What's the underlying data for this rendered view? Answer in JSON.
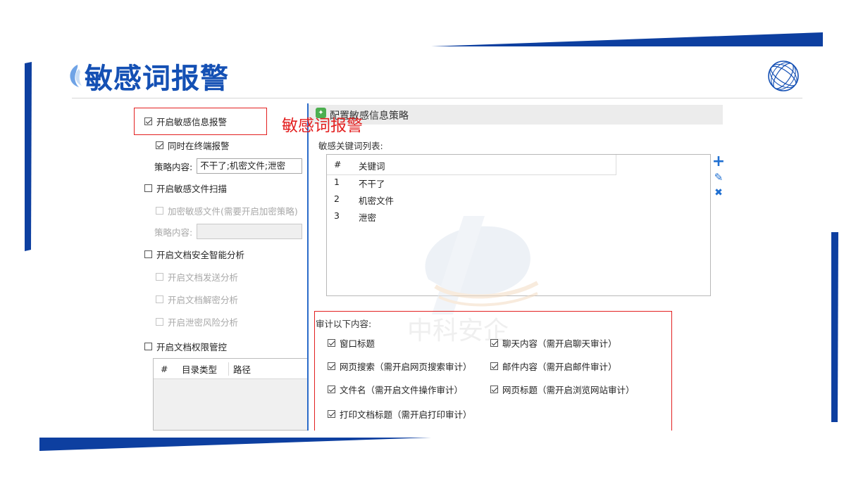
{
  "slide": {
    "title": "敏感词报警",
    "colors": {
      "brand": "#1450b4",
      "accent_dark": "#0d3fa0",
      "alert": "#e32020"
    },
    "icons": [
      "title-marker-icon",
      "globe-logo-icon"
    ]
  },
  "left_panel": {
    "items": [
      {
        "label": "开启敏感信息报警",
        "checked": true,
        "enabled": true
      },
      {
        "label": "同时在终端报警",
        "checked": true,
        "enabled": true
      },
      {
        "label": "开启敏感文件扫描",
        "checked": false,
        "enabled": true
      },
      {
        "label": "加密敏感文件(需要开启加密策略)",
        "checked": false,
        "enabled": false
      },
      {
        "label": "开启文档安全智能分析",
        "checked": false,
        "enabled": true
      },
      {
        "label": "开启文档发送分析",
        "checked": false,
        "enabled": false
      },
      {
        "label": "开启文档解密分析",
        "checked": false,
        "enabled": false
      },
      {
        "label": "开启泄密风险分析",
        "checked": false,
        "enabled": false
      },
      {
        "label": "开启文档权限管控",
        "checked": false,
        "enabled": true
      }
    ],
    "policy_label_1": "策略内容:",
    "policy_value_1": "不干了;机密文件;泄密",
    "policy_label_2": "策略内容:",
    "policy_value_2": "",
    "table_headers": [
      "#",
      "目录类型",
      "路径"
    ]
  },
  "right_panel": {
    "title": "配置敏感信息策略",
    "overlay_label": "敏感词报警",
    "keyword_list_label": "敏感关键词列表:",
    "keyword_table": {
      "headers": [
        "#",
        "关键词"
      ],
      "rows": [
        {
          "num": "1",
          "keyword": "不干了"
        },
        {
          "num": "2",
          "keyword": "机密文件"
        },
        {
          "num": "3",
          "keyword": "泄密"
        }
      ]
    },
    "tools": {
      "add": "+",
      "edit": "✎",
      "delete": "✖"
    },
    "watermark_text": "中科安企",
    "audit_label": "审计以下内容:",
    "audit_items": [
      {
        "label": "窗口标题",
        "checked": true
      },
      {
        "label": "聊天内容（需开启聊天审计）",
        "checked": true
      },
      {
        "label": "网页搜索（需开启网页搜索审计）",
        "checked": true
      },
      {
        "label": "邮件内容（需开启邮件审计）",
        "checked": true
      },
      {
        "label": "文件名（需开启文件操作审计）",
        "checked": true
      },
      {
        "label": "网页标题（需开启浏览网站审计）",
        "checked": true
      },
      {
        "label": "打印文档标题（需开启打印审计）",
        "checked": true
      }
    ]
  }
}
